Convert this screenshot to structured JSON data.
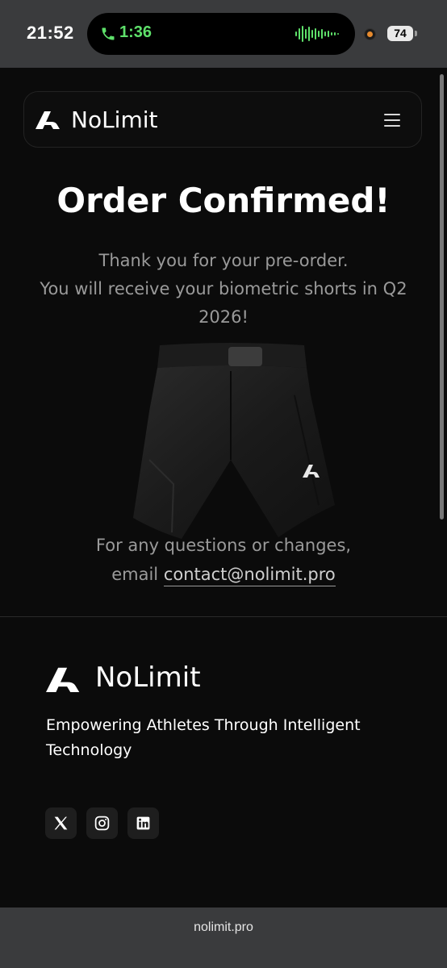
{
  "status_bar": {
    "time": "21:52",
    "call_timer": "1:36",
    "battery": "74"
  },
  "header": {
    "brand": "NoLimit",
    "logo_icon": "nolimit-logo-icon",
    "menu_icon": "hamburger-menu-icon"
  },
  "main": {
    "title": "Order Confirmed!",
    "thanks_line1": "Thank you for your pre-order.",
    "thanks_line2": "You will receive your biometric shorts in Q2 2026!",
    "contact_line1": "For any questions or changes,",
    "contact_prefix": "email",
    "contact_email": "contact@nolimit.pro"
  },
  "footer": {
    "brand": "NoLimit",
    "tagline": "Empowering Athletes Through Intelligent Technology",
    "socials": [
      {
        "icon": "x-twitter-icon"
      },
      {
        "icon": "instagram-icon"
      },
      {
        "icon": "linkedin-icon"
      }
    ]
  },
  "browser": {
    "url": "nolimit.pro"
  },
  "colors": {
    "background": "#0b0b0b",
    "muted_text": "#9a9a9a",
    "call_green": "#5ee06a",
    "chrome": "#3a3b3d"
  }
}
